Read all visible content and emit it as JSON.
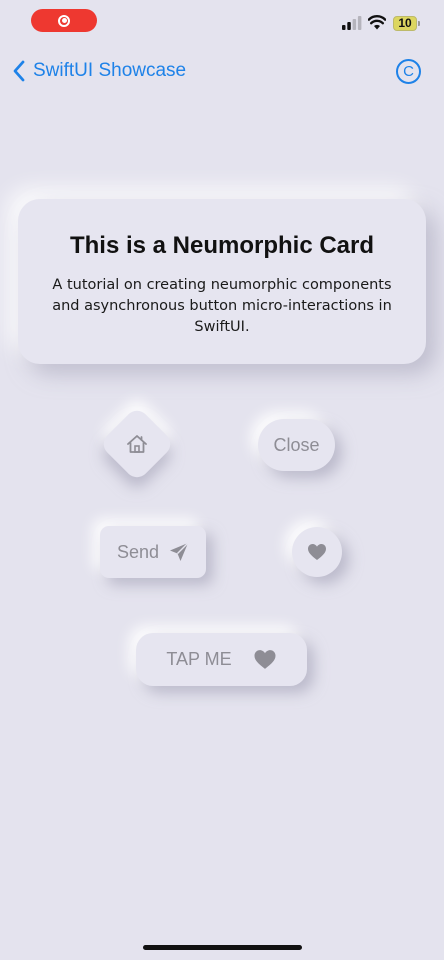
{
  "status_bar": {
    "battery_level": "10",
    "record_color": "#EE3830",
    "icons": [
      "record-icon",
      "signal-icon",
      "wifi-icon",
      "battery-icon"
    ]
  },
  "nav": {
    "back_label": "SwiftUI Showcase",
    "accent_color": "#1E82E8",
    "trailing_icon": "copyright-icon",
    "trailing_glyph": "C"
  },
  "card": {
    "title": "This is a Neumorphic Card",
    "description": "A tutorial on creating neumorphic components and asynchronous button micro-interactions in SwiftUI."
  },
  "buttons": {
    "home_icon": "house-icon",
    "close_label": "Close",
    "send_label": "Send",
    "send_icon": "paperplane-icon",
    "heart_icon": "heart-icon",
    "tap_label": "TAP ME",
    "tap_icon": "heart-icon"
  },
  "colors": {
    "background": "#E4E3EE",
    "button_text": "#8E8D95"
  }
}
